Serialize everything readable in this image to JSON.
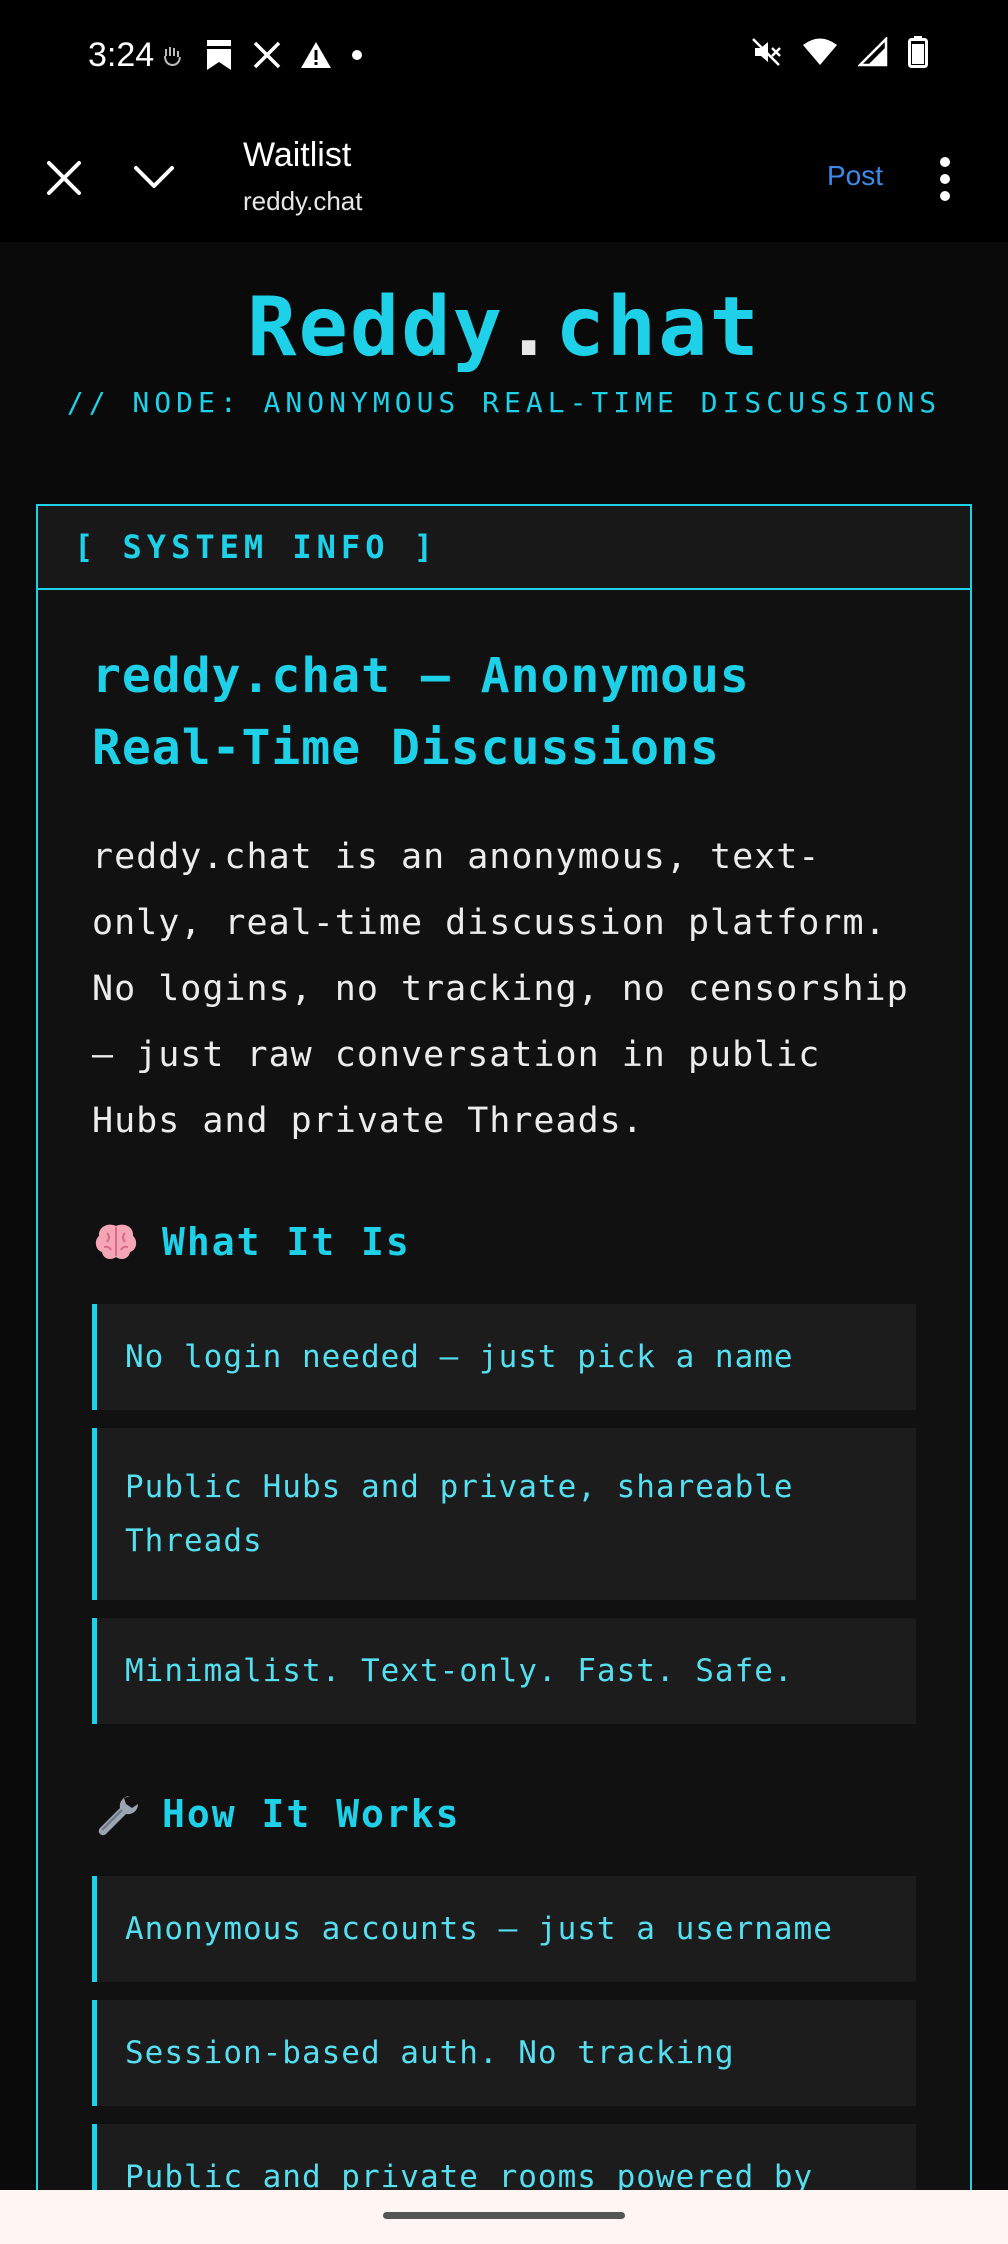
{
  "status_bar": {
    "time": "3:24"
  },
  "toolbar": {
    "title": "Waitlist",
    "url": "reddy.chat",
    "post_label": "Post"
  },
  "header": {
    "title_part1": "Reddy",
    "title_dot": ".",
    "title_part2": "chat",
    "subtitle": "// NODE: ANONYMOUS REAL-TIME DISCUSSIONS"
  },
  "panel": {
    "header": "[ SYSTEM INFO ]",
    "heading": "reddy.chat — Anonymous Real-Time Discussions",
    "intro": "reddy.chat is an anonymous, text-only, real-time discussion platform. No logins, no tracking, no censorship — just raw conversation in public Hubs and private Threads.",
    "sections": [
      {
        "title": "What It Is",
        "icon": "brain-icon",
        "items": [
          "No login needed — just pick a name",
          "Public Hubs and private, shareable Threads",
          "Minimalist. Text-only. Fast. Safe."
        ]
      },
      {
        "title": "How It Works",
        "icon": "wrench-icon",
        "items": [
          "Anonymous accounts — just a username",
          "Session-based auth. No tracking",
          "Public and private rooms powered by"
        ]
      }
    ]
  },
  "colors": {
    "accent": "#1fd1e8",
    "background": "#0a0a0a",
    "link": "#3b8beb"
  }
}
